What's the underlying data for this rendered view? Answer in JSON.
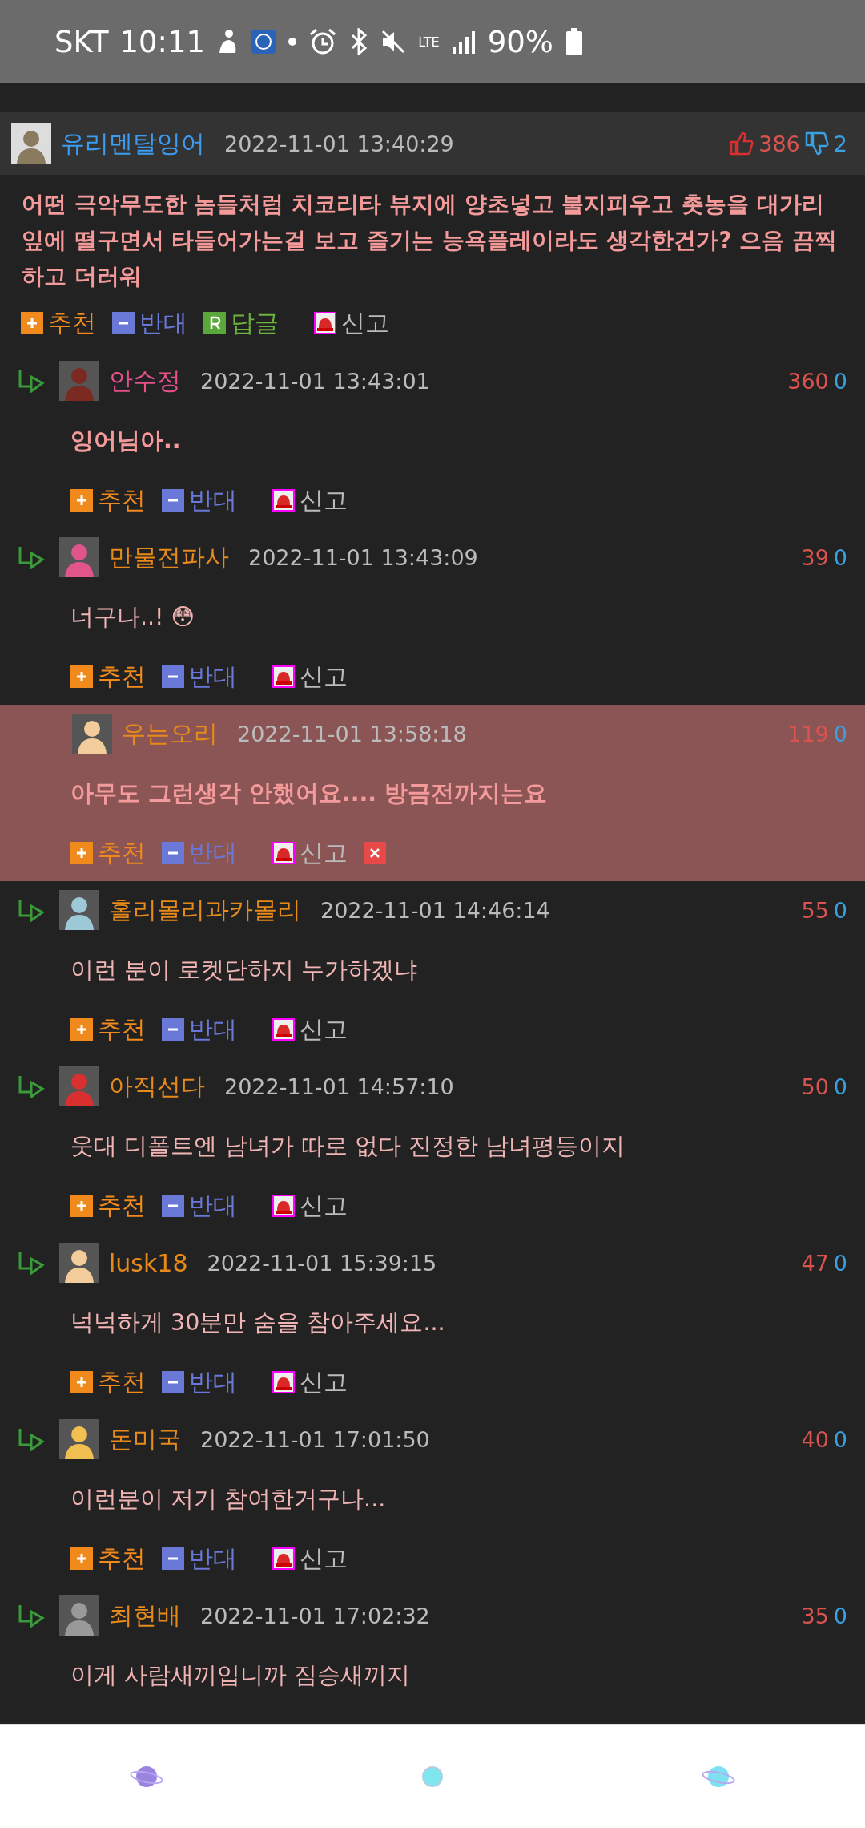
{
  "status_bar": {
    "carrier": "SKT",
    "time": "10:11",
    "battery": "90%",
    "network": "LTE"
  },
  "comment": {
    "name": "유리멘탈잉어",
    "color": "#3b9cf0",
    "time": "2022-11-01 13:40:29",
    "up": "386",
    "down": "2",
    "text": "어떤 극악무도한 놈들처럼 치코리타 뷰지에 양초넣고 불지피우고 촛농을 대가리 잎에 떨구면서 타들어가는걸 보고 즐기는 능욕플레이라도 생각한건가? 으음 끔찍하고 더러워",
    "actions": [
      {
        "kind": "up",
        "label": "추천"
      },
      {
        "kind": "down",
        "label": "반대"
      },
      {
        "kind": "reply",
        "label": "답글"
      },
      {
        "kind": "report",
        "label": "신고"
      }
    ]
  },
  "replies": [
    {
      "name": "안수정",
      "color": "#e8508a",
      "time": "2022-11-01 13:43:01",
      "up": "360",
      "down": "0",
      "text": "잉어님아..",
      "bold": true,
      "highlighted": false,
      "actions": [
        {
          "kind": "up",
          "label": "추천"
        },
        {
          "kind": "down",
          "label": "반대"
        },
        {
          "kind": "report",
          "label": "신고"
        }
      ]
    },
    {
      "name": "만물전파사",
      "color": "#e88a1a",
      "time": "2022-11-01 13:43:09",
      "up": "39",
      "down": "0",
      "text": "너구나..! 😳",
      "bold": false,
      "highlighted": false,
      "actions": [
        {
          "kind": "up",
          "label": "추천"
        },
        {
          "kind": "down",
          "label": "반대"
        },
        {
          "kind": "report",
          "label": "신고"
        }
      ]
    },
    {
      "name": "우는오리",
      "color": "#e88a1a",
      "time": "2022-11-01 13:58:18",
      "up": "119",
      "down": "0",
      "text": "아무도 그런생각 안했어요.... 방금전까지는요",
      "bold": true,
      "highlighted": true,
      "actions": [
        {
          "kind": "up",
          "label": "추천"
        },
        {
          "kind": "down",
          "label": "반대"
        },
        {
          "kind": "report",
          "label": "신고"
        }
      ]
    },
    {
      "name": "홀리몰리과카몰리",
      "color": "#e88a1a",
      "time": "2022-11-01 14:46:14",
      "up": "55",
      "down": "0",
      "text": "이런 분이 로켓단하지 누가하겠냐",
      "bold": false,
      "highlighted": false,
      "actions": [
        {
          "kind": "up",
          "label": "추천"
        },
        {
          "kind": "down",
          "label": "반대"
        },
        {
          "kind": "report",
          "label": "신고"
        }
      ]
    },
    {
      "name": "아직선다",
      "color": "#e88a1a",
      "time": "2022-11-01 14:57:10",
      "up": "50",
      "down": "0",
      "text": "웃대 디폴트엔 남녀가 따로 없다 진정한 남녀평등이지",
      "bold": false,
      "highlighted": false,
      "actions": [
        {
          "kind": "up",
          "label": "추천"
        },
        {
          "kind": "down",
          "label": "반대"
        },
        {
          "kind": "report",
          "label": "신고"
        }
      ]
    },
    {
      "name": "lusk18",
      "color": "#e88a1a",
      "time": "2022-11-01 15:39:15",
      "up": "47",
      "down": "0",
      "text": "넉넉하게 30분만 숨을 참아주세요...",
      "bold": false,
      "highlighted": false,
      "actions": [
        {
          "kind": "up",
          "label": "추천"
        },
        {
          "kind": "down",
          "label": "반대"
        },
        {
          "kind": "report",
          "label": "신고"
        }
      ]
    },
    {
      "name": "돈미국",
      "color": "#e88a1a",
      "time": "2022-11-01 17:01:50",
      "up": "40",
      "down": "0",
      "text": "이런분이 저기 참여한거구나...",
      "bold": false,
      "highlighted": false,
      "actions": [
        {
          "kind": "up",
          "label": "추천"
        },
        {
          "kind": "down",
          "label": "반대"
        },
        {
          "kind": "report",
          "label": "신고"
        }
      ]
    },
    {
      "name": "최현배",
      "color": "#e88a1a",
      "time": "2022-11-01 17:02:32",
      "up": "35",
      "down": "0",
      "text": "이게 사람새끼입니까 짐승새끼지",
      "bold": false,
      "highlighted": false
    }
  ],
  "bottom_nav": [
    {
      "kind": "ringed"
    },
    {
      "kind": "plain"
    },
    {
      "kind": "ringed"
    }
  ]
}
